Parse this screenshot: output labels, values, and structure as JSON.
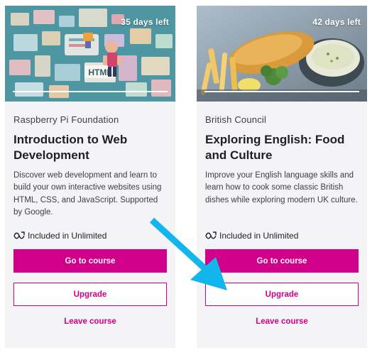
{
  "courses": [
    {
      "days_left": "35 days left",
      "provider": "Raspberry Pi Foundation",
      "title": "Introduction to Web Development",
      "description": "Discover web development and learn to build your own interactive websites using HTML, CSS, and JavaScript. Supported by Google.",
      "unlimited_label": "Included in Unlimited",
      "go_label": "Go to course",
      "upgrade_label": "Upgrade",
      "leave_label": "Leave course",
      "image_text": "HTML"
    },
    {
      "days_left": "42 days left",
      "provider": "British Council",
      "title": "Exploring English: Food and Culture",
      "description": "Improve your English language skills and learn how to cook some classic British dishes while exploring modern UK culture.",
      "unlimited_label": "Included in Unlimited",
      "go_label": "Go to course",
      "upgrade_label": "Upgrade",
      "leave_label": "Leave course"
    }
  ],
  "colors": {
    "accent": "#d0008b",
    "arrow": "#12b5ec",
    "card_bg": "#f4f4f6"
  },
  "icons": [
    "unlimited-icon",
    "arrow-annotation"
  ]
}
